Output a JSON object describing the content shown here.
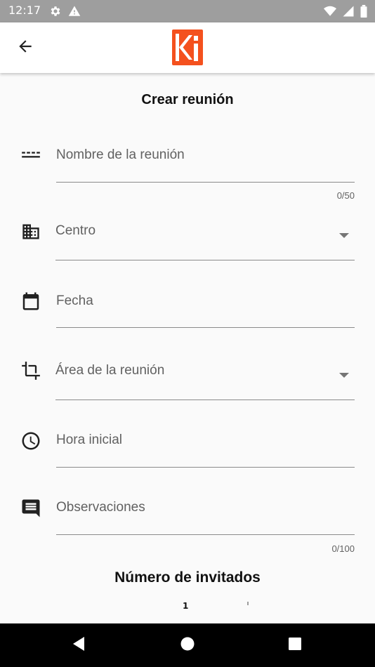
{
  "status_bar": {
    "time": "12:17",
    "icons": [
      "settings-icon",
      "warning-icon",
      "wifi-icon",
      "signal-icon",
      "battery-icon"
    ]
  },
  "app_bar": {
    "back_icon": "arrow-left-icon",
    "logo_letters": "ki",
    "brand_color": "#f4511e"
  },
  "form": {
    "title": "Crear reunión",
    "meeting_name": {
      "placeholder": "Nombre de la reunión",
      "value": "",
      "counter": "0/50",
      "icon": "short-text-icon"
    },
    "center": {
      "label": "Centro",
      "icon": "building-icon"
    },
    "date": {
      "placeholder": "Fecha",
      "value": "",
      "icon": "calendar-icon"
    },
    "area": {
      "label": "Área de la reunión",
      "icon": "crop-icon"
    },
    "start_time": {
      "placeholder": "Hora inicial",
      "value": "",
      "icon": "clock-icon"
    },
    "notes": {
      "placeholder": "Observaciones",
      "value": "",
      "counter": "0/100",
      "icon": "comment-icon"
    },
    "guests_title": "Número de invitados",
    "guests_value": "1"
  },
  "nav_bar": {
    "icons": [
      "back-triangle-icon",
      "home-circle-icon",
      "recents-square-icon"
    ]
  }
}
